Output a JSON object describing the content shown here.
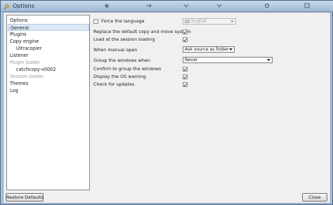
{
  "window": {
    "title": "Options"
  },
  "sidebar": {
    "items": [
      {
        "label": "Options",
        "disabled": false,
        "selected": false
      },
      {
        "label": "General",
        "disabled": false,
        "selected": true
      },
      {
        "label": "Plugins",
        "disabled": false,
        "selected": false
      },
      {
        "label": "Copy engine",
        "disabled": false,
        "selected": false
      },
      {
        "label": "Ultracopier",
        "disabled": false,
        "selected": false
      },
      {
        "label": "Listener",
        "disabled": false,
        "selected": false
      },
      {
        "label": "Plugin loader",
        "disabled": true,
        "selected": false
      },
      {
        "label": "catchcopy-v0002",
        "disabled": false,
        "selected": false
      },
      {
        "label": "Session loader",
        "disabled": true,
        "selected": false
      },
      {
        "label": "Themes",
        "disabled": false,
        "selected": false
      },
      {
        "label": "Log",
        "disabled": false,
        "selected": false
      }
    ]
  },
  "general": {
    "force_language": {
      "label": "Force the language",
      "checked": false,
      "value": "English"
    },
    "replace_copy_move": {
      "label": "Replace the default copy and move system",
      "checked": true
    },
    "load_at_session": {
      "label": "Load at the session loading",
      "checked": true
    },
    "manual_open": {
      "label": "When manual open",
      "value": "Ask source as folder"
    },
    "group_windows": {
      "label": "Group the windows when",
      "value": "Never"
    },
    "confirm_group": {
      "label": "Confirm to group the windows",
      "checked": true
    },
    "os_warning": {
      "label": "Display the OS warning",
      "checked": true
    },
    "check_updates": {
      "label": "Check for updates",
      "checked": true
    }
  },
  "footer": {
    "restore_label": "Restore Defaults",
    "close_label": "Close"
  },
  "colors": {
    "accent": "#a9c2dc",
    "selection": "#dde8f5"
  }
}
